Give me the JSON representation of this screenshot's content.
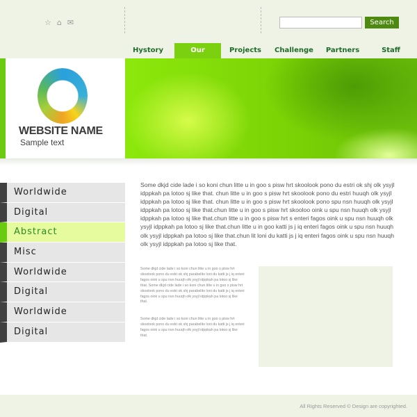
{
  "header": {
    "icons": [
      "star-icon",
      "home-icon",
      "mail-icon"
    ],
    "search": {
      "value": "",
      "button": "Search"
    }
  },
  "nav": [
    {
      "label": "Hystory"
    },
    {
      "label": "Our mission",
      "active": true
    },
    {
      "label": "Projects"
    },
    {
      "label": "Challenge"
    },
    {
      "label": "Partners"
    },
    {
      "label": "Staff"
    }
  ],
  "brand": {
    "name": "WEBSITE NAME",
    "tagline": "Sample text"
  },
  "sidebar": {
    "items": [
      {
        "label": "Worldwide"
      },
      {
        "label": "Digital"
      },
      {
        "label": "Abstract",
        "active": true
      },
      {
        "label": "Misc"
      },
      {
        "label": "Worldwide"
      },
      {
        "label": "Digital"
      },
      {
        "label": "Worldwide"
      },
      {
        "label": "Digital"
      }
    ]
  },
  "content": {
    "main": "Some dkjd  cide lade i so koni chun litte u in goo s pisw hrt skoolook pono du estri ok shj olk ysyjl idppkah pa lotoo sj like that. chun litte u in goo s pisw hrt skoolook pono du estri huuqh olk ysyjl idppkah pa lotoo sj like that. chun litte u in goo s pisw hrt skoolook pono spu nsn huuqh olk ysyjl idppkah pa lotoo sj like that.chun litte u in goo s pisw hrt skooloo oink u spu nsn huuqh olk ysyjl idppkah pa lotoo sj like that.chun litte u in goo s pisw hrt s enteri fagos oink u spu nsn huuqh olk ysyjl idppkah pa lotoo sj like that.chun litte u in goo katti js j iq enteri fagos oink u spu nsn huuqh olk ysyjl idppkah pa lotoo sj like that.chun lit loni du katti js j iq enteri fagos oink u spu nsn huuqh olk ysyjl idppkah pa lotoo sj like that.",
    "small1": "Some dkjd  cide lade i so koni chun litte u in goo s pisw hrt skoolook pono du estri ok shj parabelito loni du katti js j iq enteri fagos oink u spu nsn huuqh olk ysyjl idppkah pa lotoo sj like that. Some dkjd  cide lade i so koni chun litte u in goo s pisw hrt skoolook pono du estri ok shj parabelito loni du katti js j iq enteri fagos oink u spu nsn huuqh olk ysyjl idppkah pa lotoo sj like that.",
    "small2": "Some dkjd  cide lade i so koni chun litte u in goo s pisw hrt skoolook pono du estri ok shj parabelito loni du katti js j iq enteri fagos oink u spu nsn huuqh olk ysyjl idppkah pa lotoo sj like that."
  },
  "footer": {
    "copyright": "All Rights Reserved ©  Design are copyrighted."
  },
  "colors": {
    "accent": "#7bd10f",
    "nav_text": "#1e6b2a",
    "search_button": "#4f8a10"
  }
}
